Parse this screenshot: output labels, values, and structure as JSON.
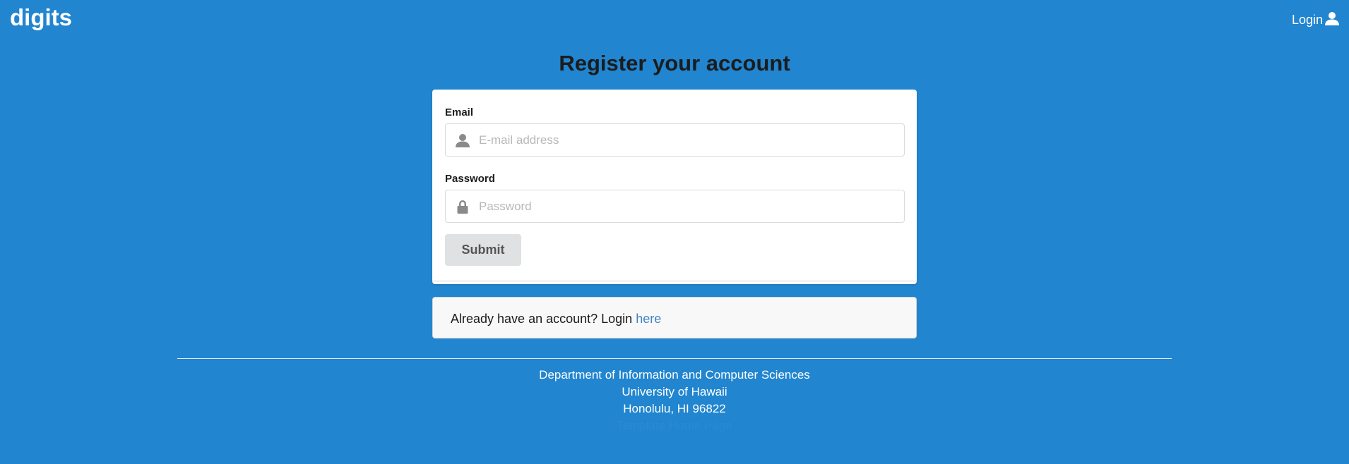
{
  "navbar": {
    "brand": "digits",
    "login_label": "Login",
    "login_icon": "user-icon"
  },
  "page": {
    "title": "Register your account"
  },
  "form": {
    "email": {
      "label": "Email",
      "placeholder": "E-mail address",
      "value": "",
      "icon": "user-icon"
    },
    "password": {
      "label": "Password",
      "placeholder": "Password",
      "value": "",
      "icon": "lock-icon"
    },
    "submit_label": "Submit"
  },
  "login_message": {
    "text": "Already have an account? Login ",
    "link_text": "here"
  },
  "footer": {
    "line1": "Department of Information and Computer Sciences",
    "line2": "University of Hawaii",
    "line3": "Honolulu, HI 96822",
    "link_text": "Template Home Page"
  },
  "colors": {
    "background": "#2185d0",
    "link": "#4183c4",
    "button": "#e0e1e2"
  }
}
